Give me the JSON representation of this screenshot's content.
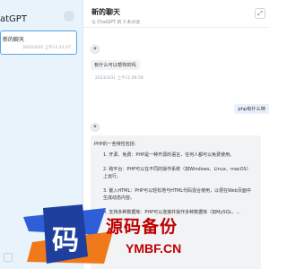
{
  "sidebar": {
    "brand": "atGPT",
    "conversation": {
      "title": "新的聊天",
      "time": "2023/3/31 上午11:11:27"
    }
  },
  "header": {
    "title": "新的聊天",
    "subtitle": "与 ChatGPT 的 3 条对话"
  },
  "messages": {
    "question": "有什么可以帮你的吗",
    "question_time": "2023/3/31 上午11:09:59",
    "user_text": "php有什么特",
    "answer_intro": "PHP的一些特性包括：",
    "answer_points": [
      "1. 开源、免费：PHP是一种开源的语言，任何人都可以免费使用。",
      "2. 跨平台：PHP可以在不同的操作系统（如Windows、Linux、macOS）上运行。",
      "3. 嵌入HTML：PHP可以轻松地与HTML代码混合使用，以便在Web页面中生成动态内容。",
      "4. 支持多种数据库：PHP可以连接并操作多种数据库（如MySQL、..."
    ]
  },
  "watermark": {
    "char": "码",
    "main": "源码备份",
    "sub": "YMBF.CN"
  },
  "colors": {
    "accent": "#5aa4e6",
    "watermark_red": "#c00000",
    "watermark_blue": "#2f5fd8",
    "watermark_orange": "#f07a1a"
  },
  "icons": {
    "sidebar_settings": "gear-icon",
    "header_action": "expand-icon",
    "assistant": "bot-avatar-icon"
  }
}
